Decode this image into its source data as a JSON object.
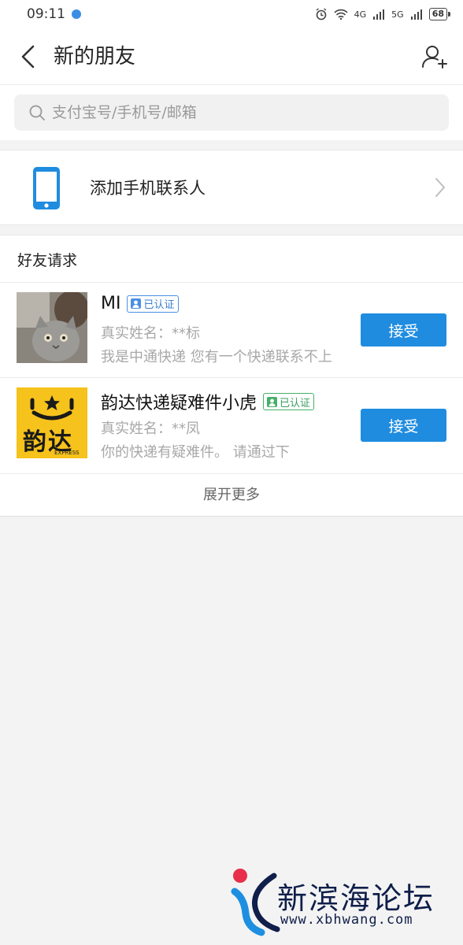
{
  "status_bar": {
    "time": "09:11",
    "network_labels": [
      "4G",
      "5G"
    ],
    "battery": "68"
  },
  "header": {
    "title": "新的朋友",
    "back_icon": "chevron-left-icon",
    "add_icon": "add-user-icon"
  },
  "search": {
    "placeholder": "支付宝号/手机号/邮箱"
  },
  "contacts": {
    "label": "添加手机联系人",
    "icon": "phone-icon"
  },
  "requests": {
    "section_title": "好友请求",
    "items": [
      {
        "name": "MI",
        "badge": "已认证",
        "badge_color": "#4a90e2",
        "real_name": "真实姓名：**标",
        "message": "我是中通快递 您有一个快递联系不上",
        "button": "接受"
      },
      {
        "name": "韵达快递疑难件小虎",
        "badge": "已认证",
        "badge_color": "#45b06a",
        "real_name": "真实姓名：**凤",
        "message": "你的快递有疑难件。 请通过下",
        "button": "接受",
        "avatar_text": "韵达",
        "avatar_sub": "EXPRESS"
      }
    ],
    "expand": "展开更多"
  },
  "watermark": {
    "title": "新滨海论坛",
    "url": "www.xbhwang.com"
  },
  "colors": {
    "accent": "#1f8ce0",
    "background": "#f3f3f3"
  }
}
